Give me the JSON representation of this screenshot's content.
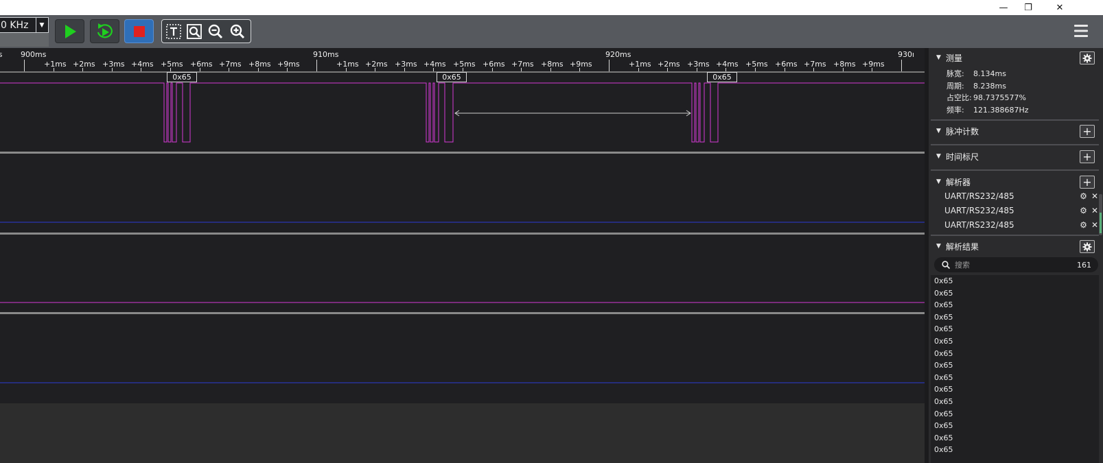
{
  "window": {
    "minimize_glyph": "—",
    "restore_glyph": "❐",
    "close_glyph": "✕"
  },
  "toolbar": {
    "sample_rate": "0 KHz",
    "dropdown_glyph": "▼",
    "accent_colors": {
      "start": "#1fcf1f",
      "stop": "#e0221f",
      "stop_bg": "#2f6fb8"
    }
  },
  "ruler": {
    "major_labels": [
      {
        "text": "ms",
        "pos": 0
      },
      {
        "text": "900ms",
        "pos": 1
      },
      {
        "text": "910ms",
        "pos": 2
      },
      {
        "text": "920ms",
        "pos": 3
      },
      {
        "text": "930ı",
        "pos": 4
      }
    ],
    "minor_labels": [
      "+1ms",
      "+2ms",
      "+3ms",
      "+4ms",
      "+5ms",
      "+6ms",
      "+7ms",
      "+8ms",
      "+9ms"
    ]
  },
  "decode_labels": [
    "0x65",
    "0x65",
    "0x65"
  ],
  "channel_colors": [
    "#d63ad6",
    "#2b3bd6",
    "#d63ad6",
    "#2b3bd6"
  ],
  "panel": {
    "measure": {
      "title": "测量",
      "rows": [
        {
          "label": "脉宽:",
          "value": "8.134ms"
        },
        {
          "label": "周期:",
          "value": "8.238ms"
        },
        {
          "label": "占空比:",
          "value": "98.7375577%"
        },
        {
          "label": "频率:",
          "value": "121.388687Hz"
        }
      ]
    },
    "pulse_count": {
      "title": "脉冲计数"
    },
    "time_ruler": {
      "title": "时间标尺"
    },
    "decoders": {
      "title": "解析器",
      "items": [
        "UART/RS232/485",
        "UART/RS232/485",
        "UART/RS232/485"
      ]
    },
    "results": {
      "title": "解析结果",
      "search_placeholder": "搜索",
      "count": "161",
      "items": [
        "0x65",
        "0x65",
        "0x65",
        "0x65",
        "0x65",
        "0x65",
        "0x65",
        "0x65",
        "0x65",
        "0x65",
        "0x65",
        "0x65",
        "0x65",
        "0x65",
        "0x65"
      ]
    }
  }
}
